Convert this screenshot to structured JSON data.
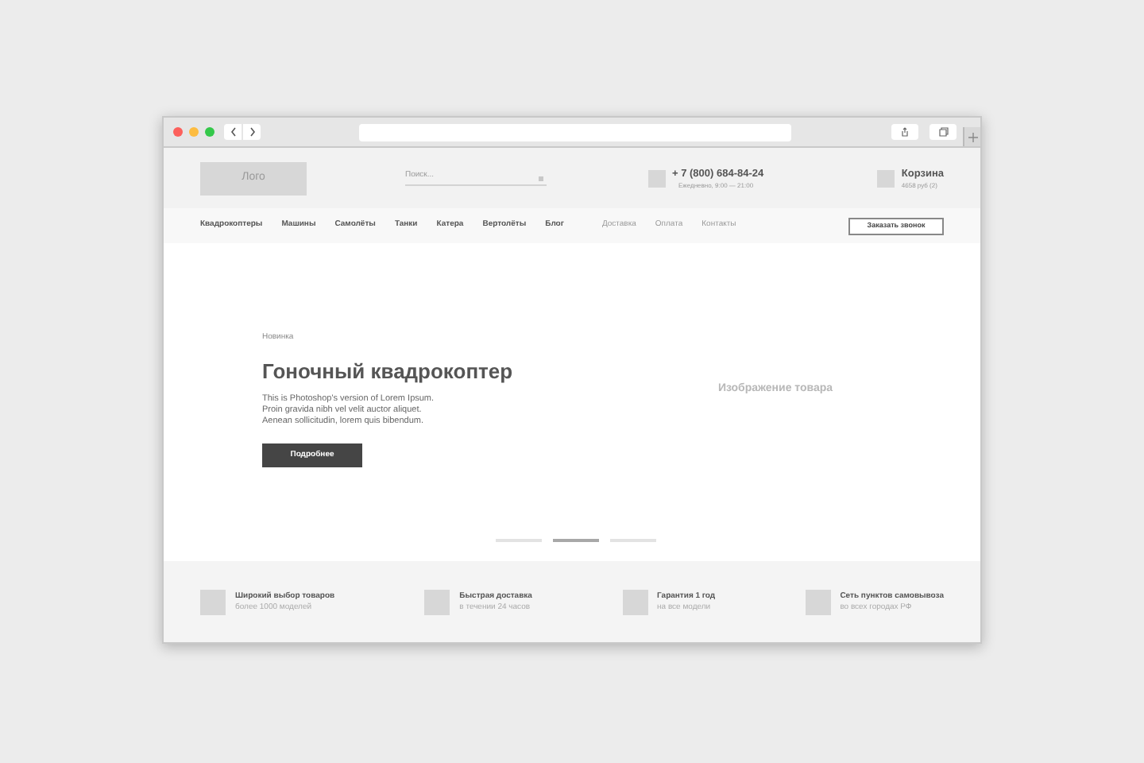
{
  "header": {
    "logo": "Лого",
    "search": {
      "placeholder": "Поиск..."
    },
    "phone": {
      "number": "+ 7 (800) 684-84-24",
      "hours": "Ежедневно, 9:00 — 21:00"
    },
    "cart": {
      "title": "Корзина",
      "summary": "4658 руб (2)"
    }
  },
  "nav": {
    "categories": [
      "Квадрокоптеры",
      "Машины",
      "Самолёты",
      "Танки",
      "Катера",
      "Вертолёты",
      "Блог"
    ],
    "links": [
      "Доставка",
      "Оплата",
      "Контакты"
    ],
    "callback_button": "Заказать звонок"
  },
  "hero": {
    "tag": "Новинка",
    "title": "Гоночный квадрокоптер",
    "description": [
      "This is Photoshop's version  of Lorem Ipsum.",
      "Proin gravida nibh vel velit auctor aliquet.",
      "Aenean sollicitudin, lorem quis bibendum."
    ],
    "button": "Подробнее",
    "image_label": "Изображение товара",
    "slides": [
      {
        "selected": false
      },
      {
        "selected": true
      },
      {
        "selected": false
      }
    ]
  },
  "features": [
    {
      "title": "Широкий выбор товаров",
      "subtitle": "более 1000 моделей"
    },
    {
      "title": "Быстрая доставка",
      "subtitle": "в течении 24 часов"
    },
    {
      "title": "Гарантия 1 год",
      "subtitle": "на все модели"
    },
    {
      "title": "Сеть пунктов самовывоза",
      "subtitle": "во всех городах РФ"
    }
  ]
}
